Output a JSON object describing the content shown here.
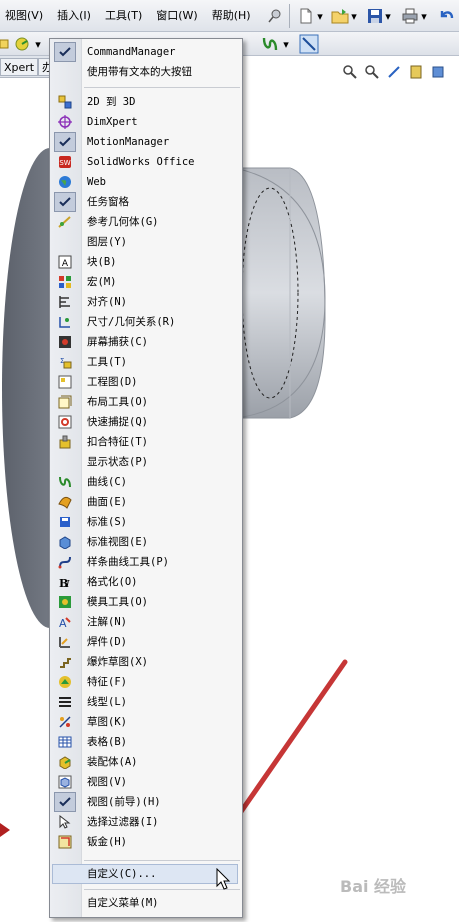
{
  "menubar": {
    "items": [
      {
        "label": "视图(V)"
      },
      {
        "label": "插入(I)"
      },
      {
        "label": "工具(T)"
      },
      {
        "label": "窗口(W)"
      },
      {
        "label": "帮助(H)"
      }
    ]
  },
  "tabs": {
    "feature_tab": "Xpert",
    "second_tab": "办"
  },
  "context_menu": {
    "top_items": [
      {
        "label": "CommandManager",
        "checked": true
      },
      {
        "label": "使用带有文本的大按钮",
        "checked": false
      }
    ],
    "toolbar_items": [
      {
        "label": "2D 到 3D",
        "icon": "2d-to-3d-icon",
        "checked": false
      },
      {
        "label": "DimXpert",
        "icon": "dimxpert-icon",
        "checked": false
      },
      {
        "label": "MotionManager",
        "icon": "check-icon",
        "checked": true
      },
      {
        "label": "SolidWorks Office",
        "icon": "solidworks-office-icon",
        "checked": false
      },
      {
        "label": "Web",
        "icon": "globe-icon",
        "checked": false
      },
      {
        "label": "任务窗格",
        "icon": "check-icon",
        "checked": true
      },
      {
        "label": "参考几何体(G)",
        "icon": "reference-geometry-icon",
        "checked": false
      },
      {
        "label": "图层(Y)",
        "icon": "",
        "checked": false
      },
      {
        "label": "块(B)",
        "icon": "block-icon",
        "checked": false
      },
      {
        "label": "宏(M)",
        "icon": "macro-icon",
        "checked": false
      },
      {
        "label": "对齐(N)",
        "icon": "align-icon",
        "checked": false
      },
      {
        "label": "尺寸/几何关系(R)",
        "icon": "dimension-icon",
        "checked": false
      },
      {
        "label": "屏幕捕获(C)",
        "icon": "screen-capture-icon",
        "checked": false
      },
      {
        "label": "工具(T)",
        "icon": "tools-icon",
        "checked": false
      },
      {
        "label": "工程图(D)",
        "icon": "drawing-icon",
        "checked": false
      },
      {
        "label": "布局工具(O)",
        "icon": "layout-icon",
        "checked": false
      },
      {
        "label": "快速捕捉(Q)",
        "icon": "quick-snap-icon",
        "checked": false
      },
      {
        "label": "扣合特征(T)",
        "icon": "fastening-icon",
        "checked": false
      },
      {
        "label": "显示状态(P)",
        "icon": "",
        "checked": false
      },
      {
        "label": "曲线(C)",
        "icon": "curve-icon",
        "checked": false
      },
      {
        "label": "曲面(E)",
        "icon": "surface-icon",
        "checked": false
      },
      {
        "label": "标准(S)",
        "icon": "standard-icon",
        "checked": false
      },
      {
        "label": "标准视图(E)",
        "icon": "standard-views-icon",
        "checked": false
      },
      {
        "label": "样条曲线工具(P)",
        "icon": "spline-icon",
        "checked": false
      },
      {
        "label": "格式化(O)",
        "icon": "format-icon",
        "checked": false
      },
      {
        "label": "模具工具(O)",
        "icon": "mold-icon",
        "checked": false
      },
      {
        "label": "注解(N)",
        "icon": "annotation-icon",
        "checked": false
      },
      {
        "label": "焊件(D)",
        "icon": "weldment-icon",
        "checked": false
      },
      {
        "label": "爆炸草图(X)",
        "icon": "explode-sketch-icon",
        "checked": false
      },
      {
        "label": "特征(F)",
        "icon": "features-icon",
        "checked": false
      },
      {
        "label": "线型(L)",
        "icon": "line-format-icon",
        "checked": false
      },
      {
        "label": "草图(K)",
        "icon": "sketch-icon",
        "checked": false
      },
      {
        "label": "表格(B)",
        "icon": "table-icon",
        "checked": false
      },
      {
        "label": "装配体(A)",
        "icon": "assembly-icon",
        "checked": false
      },
      {
        "label": "视图(V)",
        "icon": "view-icon",
        "checked": false
      },
      {
        "label": "视图(前导)(H)",
        "icon": "check-icon",
        "checked": true
      },
      {
        "label": "选择过滤器(I)",
        "icon": "selection-filter-icon",
        "checked": false
      },
      {
        "label": "钣金(H)",
        "icon": "sheet-metal-icon",
        "checked": false
      }
    ],
    "customize": {
      "label": "自定义(C)..."
    },
    "customize_menu": {
      "label": "自定义菜单(M)"
    }
  },
  "watermark": "Bai 经验"
}
